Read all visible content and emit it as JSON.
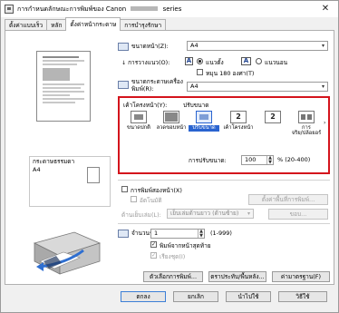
{
  "window": {
    "title": "การกำหนดลักษณะการพิมพ์ของ Canon",
    "title_suffix": "series",
    "close_glyph": "✕"
  },
  "tabs": [
    {
      "label": "ตั้งค่าแบบเร็ว"
    },
    {
      "label": "หลัก"
    },
    {
      "label": "ตั้งค่าหน้ากระดาษ"
    },
    {
      "label": "การบำรุงรักษา"
    }
  ],
  "preview": {
    "paper_caption_line1": "กระดาษธรรมดา",
    "paper_caption_line2": "A4"
  },
  "page_setup": {
    "page_size_label": "ขนาดหน้า(Z):",
    "page_size_value": "A4",
    "orientation_label": "การวางแนว(O):",
    "portrait_label": "แนวตั้ง",
    "landscape_label": "แนวนอน",
    "rotate180_label": "หมุน 180 องศา(T)",
    "printer_paper_label_1": "ขนาดกระดาษเครื่อง",
    "printer_paper_label_2": "พิมพ์(R):",
    "printer_paper_value": "A4"
  },
  "layout": {
    "label": "เค้าโครงหน้า(Y):",
    "current": "ปรับขนาด",
    "options": [
      {
        "label": "ขนาดปกติ"
      },
      {
        "label": "ลวดขอบหน้า"
      },
      {
        "label": "ปรับขนาด"
      },
      {
        "label": "เค้าโครงหน้า"
      },
      {
        "label": "การ"
      },
      {
        "label": "จริย/ปล้อยอร์"
      }
    ],
    "option_numbers": [
      "2",
      "2"
    ],
    "scale_label": "การปรับขนาด:",
    "scale_value": "100",
    "scale_range": "% (20-400)"
  },
  "duplex": {
    "two_sided_label": "การพิมพ์สองหน้า(X)",
    "auto_label": "อัตโนมัติ",
    "print_area_button": "ตั้งค่าพื้นที่การพิมพ์...",
    "staple_label": "ด้านเย็บเล่ม(L):",
    "staple_value": "เย็บเล่มด้านยาว (ด้านซ้าย)",
    "margin_button": "ขอบ..."
  },
  "copies": {
    "label": "จำนวนชุด(C):",
    "value": "1",
    "range": "(1-999)",
    "from_last_label": "พิมพ์จากหน้าสุดท้าย",
    "collate_label": "เรียงชุด(I)",
    "from_last_checked": "✓",
    "collate_checked": "✓"
  },
  "bottom_buttons": {
    "print_options": "ตัวเลือกการพิมพ์...",
    "stamp_bg": "ตราประทับ/พื้นหลัง...",
    "defaults": "ค่ามาตรฐาน(F)"
  },
  "dialog_buttons": {
    "ok": "ตกลง",
    "cancel": "ยกเลิก",
    "apply": "นำไปใช้",
    "help": "วิธีใช้"
  },
  "icons": {
    "portrait": "A",
    "landscape": "A",
    "dropdown": "▾"
  },
  "colors": {
    "highlight_border": "#d4141c",
    "selected": "#2a64d0"
  }
}
